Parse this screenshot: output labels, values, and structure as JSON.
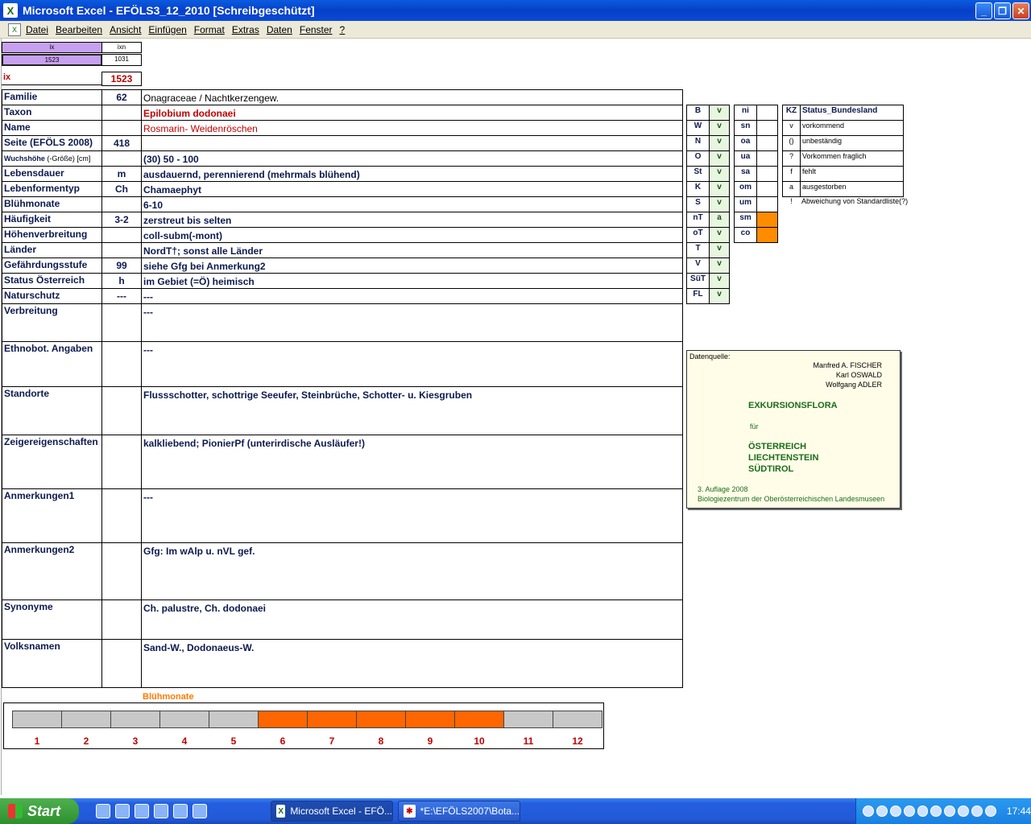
{
  "window": {
    "title": "Microsoft Excel - EFÖLS3_12_2010  [Schreibgeschützt]",
    "app_icon": "excel-x-icon"
  },
  "menu": [
    "Datei",
    "Bearbeiten",
    "Ansicht",
    "Einfügen",
    "Format",
    "Extras",
    "Daten",
    "Fenster",
    "?"
  ],
  "top": {
    "ix_head": "ix",
    "ixn_head": "ixn",
    "ix_val": "1523",
    "ixn_val": "1031",
    "ix_label": "ix",
    "ix_big": "1523"
  },
  "rows": [
    {
      "label": "Familie",
      "code": "62",
      "value": "Onagraceae  /  Nachtkerzengew."
    },
    {
      "label": "Taxon",
      "code": "",
      "value": "Epilobium dodonaei"
    },
    {
      "label": "Name",
      "code": "",
      "value": "Rosmarin- Weidenröschen"
    },
    {
      "label": "Seite (EFÖLS 2008)",
      "code": "418",
      "value": ""
    },
    {
      "label": "Wuchshöhe",
      "label_small": " (-Größe) [cm]",
      "code": "",
      "value": "(30) 50 - 100"
    },
    {
      "label": "Lebensdauer",
      "code": "m",
      "value": "ausdauernd, perennierend (mehrmals blühend)"
    },
    {
      "label": "Lebenformentyp",
      "code": "Ch",
      "value": "Chamaephyt"
    },
    {
      "label": "Blühmonate",
      "code": "",
      "value": "6-10"
    },
    {
      "label": "Häufigkeit",
      "code": "3-2",
      "value": "zerstreut bis selten"
    },
    {
      "label": "Höhenverbreitung",
      "code": "",
      "value": "coll-subm(-mont)"
    },
    {
      "label": "Länder",
      "code": "",
      "value": "NordT†; sonst alle Länder"
    },
    {
      "label": "Gefährdungsstufe",
      "code": "99",
      "value": "siehe Gfg bei Anmerkung2"
    },
    {
      "label": "Status Österreich",
      "code": "h",
      "value": "im Gebiet (=Ö) heimisch"
    },
    {
      "label": "Naturschutz",
      "code": "---",
      "value": "---"
    },
    {
      "label": "Verbreitung",
      "code": "",
      "value": "---"
    },
    {
      "label": "Ethnobot. Angaben",
      "code": "",
      "value": "---"
    },
    {
      "label": "Standorte",
      "code": "",
      "value": "Flussschotter, schottrige Seeufer, Steinbrüche, Schotter- u. Kiesgruben"
    },
    {
      "label": "Zeigereigenschaften",
      "code": "",
      "value": "kalkliebend; PionierPf (unterirdische Ausläufer!)"
    },
    {
      "label": "Anmerkungen1",
      "code": "",
      "value": "---"
    },
    {
      "label": "Anmerkungen2",
      "code": "",
      "value": "Gfg: Im wAlp u. nVL gef."
    },
    {
      "label": "Synonyme",
      "code": "",
      "value": "Ch. palustre, Ch. dodonaei"
    },
    {
      "label": "Volksnamen",
      "code": "",
      "value": "Sand-W., Dodonaeus-W."
    }
  ],
  "states": [
    {
      "k": "B",
      "v": "v"
    },
    {
      "k": "W",
      "v": "v"
    },
    {
      "k": "N",
      "v": "v"
    },
    {
      "k": "O",
      "v": "v"
    },
    {
      "k": "St",
      "v": "v"
    },
    {
      "k": "K",
      "v": "v"
    },
    {
      "k": "S",
      "v": "v"
    },
    {
      "k": "nT",
      "v": "a"
    },
    {
      "k": "oT",
      "v": "v"
    },
    {
      "k": "T",
      "v": "v"
    },
    {
      "k": "V",
      "v": "v"
    },
    {
      "k": "SüT",
      "v": "v"
    },
    {
      "k": "FL",
      "v": "v"
    }
  ],
  "alt": [
    {
      "k": "ni",
      "v": ""
    },
    {
      "k": "sn",
      "v": ""
    },
    {
      "k": "oa",
      "v": ""
    },
    {
      "k": "ua",
      "v": ""
    },
    {
      "k": "sa",
      "v": ""
    },
    {
      "k": "om",
      "v": ""
    },
    {
      "k": "um",
      "v": ""
    },
    {
      "k": "sm",
      "v": "",
      "on": true
    },
    {
      "k": "co",
      "v": "",
      "on": true
    }
  ],
  "legend": {
    "head_k": "KZ",
    "head_v": "Status_Bundesland",
    "items": [
      {
        "k": "v",
        "v": "vorkommend"
      },
      {
        "k": "()",
        "v": "unbeständig"
      },
      {
        "k": "?",
        "v": "Vorkommen fraglich"
      },
      {
        "k": "f",
        "v": "fehlt"
      },
      {
        "k": "a",
        "v": "ausgestorben"
      },
      {
        "k": "!",
        "v": "Abweichung von Standardliste(?)"
      }
    ]
  },
  "source": {
    "head": "Datenquelle:",
    "a1": "Manfred A. FISCHER",
    "a2": "Karl OSWALD",
    "a3": "Wolfgang ADLER",
    "t1": "EXKURSIONSFLORA",
    "t2": "für",
    "t3": "ÖSTERREICH",
    "t4": "LIECHTENSTEIN",
    "t5": "SÜDTIROL",
    "e1": "3. Auflage 2008",
    "e2": "Biologiezentrum der Oberösterreichischen Landesmuseen"
  },
  "bloom": {
    "title": "Blühmonate",
    "months": [
      "1",
      "2",
      "3",
      "4",
      "5",
      "6",
      "7",
      "8",
      "9",
      "10",
      "11",
      "12"
    ],
    "active": [
      false,
      false,
      false,
      false,
      false,
      true,
      true,
      true,
      true,
      true,
      false,
      false
    ]
  },
  "taskbar": {
    "start": "Start",
    "task1": "Microsoft Excel - EFÖ...",
    "task2": "*E:\\EFÖLS2007\\Bota...",
    "clock": "17:44"
  }
}
